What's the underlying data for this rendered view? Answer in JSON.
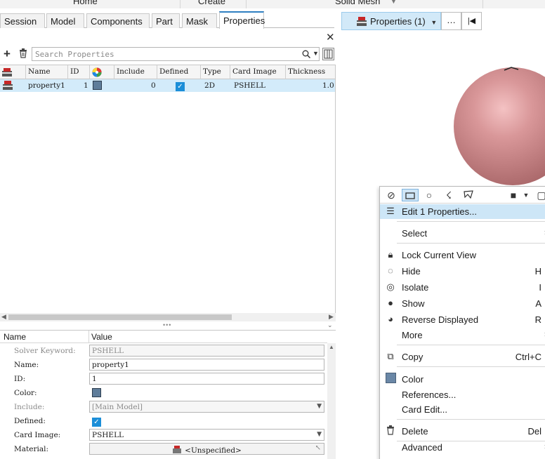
{
  "ribbon": {
    "home": "Home",
    "create": "Create",
    "solid_mesh": "Solid Mesh"
  },
  "tabs": [
    {
      "label": "Session"
    },
    {
      "label": "Model"
    },
    {
      "label": "Components"
    },
    {
      "label": "Part"
    },
    {
      "label": "Mask"
    },
    {
      "label": "Properties"
    }
  ],
  "search": {
    "placeholder": "Search Properties"
  },
  "table": {
    "headers": [
      "Name",
      "ID",
      "",
      "Include",
      "Defined",
      "Type",
      "Card Image",
      "Thickness"
    ],
    "rows": [
      {
        "name": "property1",
        "id": "1",
        "color": "#5f7d9a",
        "include": "0",
        "defined": true,
        "type": "2D",
        "card_image": "PSHELL",
        "thickness": "1.0"
      }
    ]
  },
  "editor": {
    "col_name": "Name",
    "col_value": "Value",
    "rows": [
      {
        "label": "Solver Keyword:",
        "value": "PSHELL"
      },
      {
        "label": "Name:",
        "value": "property1"
      },
      {
        "label": "ID:",
        "value": "1"
      },
      {
        "label": "Color:",
        "value": ""
      },
      {
        "label": "Include:",
        "value": "[Main Model]"
      },
      {
        "label": "Defined:",
        "value": ""
      },
      {
        "label": "Card Image:",
        "value": "PSHELL"
      },
      {
        "label": "Material:",
        "value": "<Unspecified>"
      }
    ]
  },
  "viewport": {
    "properties_button": "Properties (1)",
    "more_button": "…",
    "sphere_color": "#d68f90"
  },
  "context_menu": {
    "edit": "Edit 1 Properties...",
    "select": "Select",
    "lock_view": "Lock Current View",
    "hide": {
      "label": "Hide",
      "key": "H"
    },
    "isolate": {
      "label": "Isolate",
      "key": "I"
    },
    "show": {
      "label": "Show",
      "key": "A"
    },
    "reverse": {
      "label": "Reverse Displayed",
      "key": "R"
    },
    "more": "More",
    "copy": {
      "label": "Copy",
      "key": "Ctrl+C"
    },
    "color": "Color",
    "references": "References...",
    "card_edit": "Card Edit...",
    "delete": {
      "label": "Delete",
      "key": "Del"
    },
    "advanced": "Advanced"
  }
}
